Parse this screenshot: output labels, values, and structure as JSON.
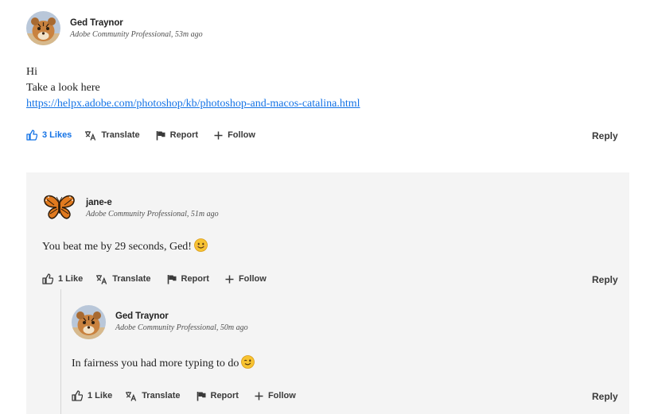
{
  "post": {
    "author": "Ged Traynor",
    "rank": "Adobe Community Professional, 53m ago",
    "lines": [
      "Hi",
      "Take a look here"
    ],
    "link": "https://helpx.adobe.com/photoshop/kb/photoshop-and-macos-catalina.html",
    "actions": {
      "likes": "3 Likes",
      "translate": "Translate",
      "report": "Report",
      "follow": "Follow",
      "reply": "Reply"
    }
  },
  "reply1": {
    "author": "jane-e",
    "rank": "Adobe Community Professional, 51m ago",
    "text": "You beat me by 29 seconds, Ged!",
    "actions": {
      "likes": "1 Like",
      "translate": "Translate",
      "report": "Report",
      "follow": "Follow",
      "reply": "Reply"
    }
  },
  "reply2": {
    "author": "Ged Traynor",
    "rank": "Adobe Community Professional, 50m ago",
    "text": "In fairness you had more typing to do",
    "actions": {
      "likes": "1 Like",
      "translate": "Translate",
      "report": "Report",
      "follow": "Follow",
      "reply": "Reply"
    }
  },
  "icons": {
    "avatar_ged": "tiger-cub-avatar",
    "avatar_jane": "butterfly-avatar",
    "like": "thumbs-up-icon",
    "translate": "translate-icon",
    "report": "flag-icon",
    "follow": "plus-icon",
    "emoji1": "smiling-face-emoji",
    "emoji2": "winking-face-emoji"
  },
  "colors": {
    "accent": "#1473e6",
    "reply_background": "#f4f4f4"
  }
}
